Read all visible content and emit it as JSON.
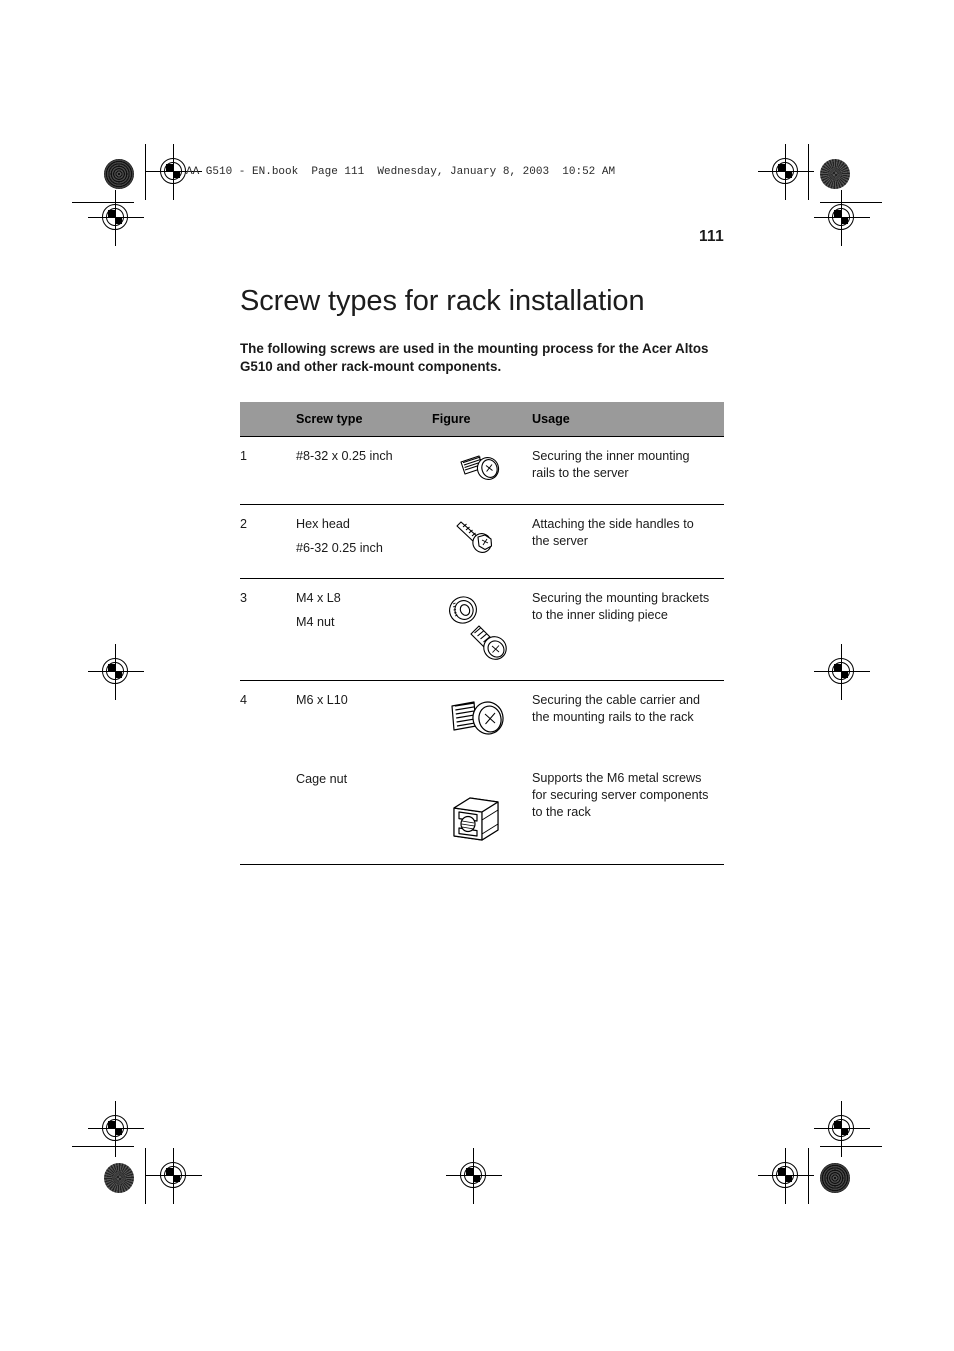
{
  "print_header": {
    "text": "AA G510 - EN.book  Page 111  Wednesday, January 8, 2003  10:52 AM"
  },
  "page": {
    "number": "111",
    "title": "Screw types for rack installation",
    "intro": "The following screws are used in the mounting process for the Acer Altos G510 and other rack-mount components."
  },
  "colors": {
    "link_blue": "#2632cf",
    "header_gray": "#9a9a9a",
    "text_black": "#1a1a1a"
  },
  "table": {
    "headers": {
      "number": "",
      "screw_type": "Screw type",
      "figure": "Figure",
      "usage": "Usage"
    },
    "rows": [
      {
        "number": "1",
        "type_lines": [
          "#8-32 x 0.25 inch"
        ],
        "figure_icon": "pan-head-screw-small-icon",
        "usage": "Securing the inner mounting rails to the server",
        "is_link": true
      },
      {
        "number": "2",
        "type_lines": [
          "Hex head",
          "#6-32 0.25 inch"
        ],
        "figure_icon": "hex-head-screw-icon",
        "usage": "Attaching the side handles to the server",
        "is_link": false
      },
      {
        "number": "3",
        "type_lines": [
          "M4 x L8",
          "M4 nut"
        ],
        "figure_icon": "nut-and-screw-icon",
        "usage": "Securing the mounting brackets to the inner sliding piece",
        "is_link": true
      },
      {
        "number": "4",
        "type_lines": [
          "M6 x L10"
        ],
        "figure_icon": "pan-head-screw-large-icon",
        "usage": "Securing the cable carrier and the mounting rails to the rack",
        "is_link": false,
        "sub_item": {
          "type_lines": [
            "Cage nut"
          ],
          "figure_icon": "cage-nut-icon",
          "usage": "Supports the M6 metal screws for securing server components to the rack"
        }
      }
    ]
  }
}
